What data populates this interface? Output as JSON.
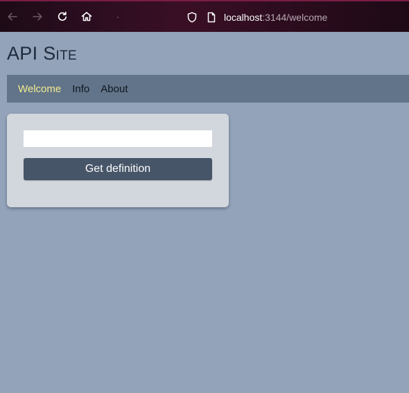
{
  "browser": {
    "url_host": "localhost",
    "url_rest": ":3144/welcome",
    "icons": [
      "back-arrow-icon",
      "forward-arrow-icon",
      "reload-icon",
      "home-icon",
      "shield-icon",
      "page-icon"
    ]
  },
  "site": {
    "title": "API Site",
    "nav": [
      {
        "label": "Welcome",
        "active": true
      },
      {
        "label": "Info",
        "active": false
      },
      {
        "label": "About",
        "active": false
      }
    ]
  },
  "card": {
    "input_value": "",
    "button_label": "Get definition"
  },
  "colors": {
    "page_background": "#93a3b9",
    "nav_background": "#627489",
    "nav_active": "#f2ea8f",
    "card_background": "#d2d6dd",
    "button_background": "#475569"
  }
}
